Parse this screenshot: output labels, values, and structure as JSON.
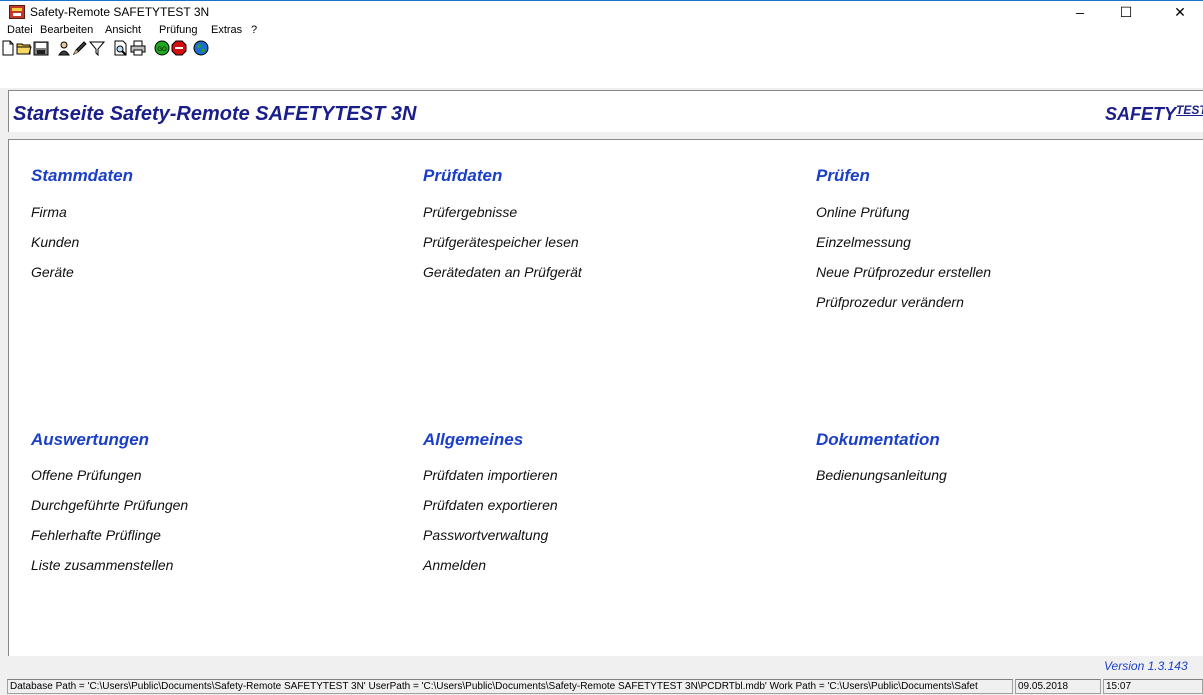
{
  "window": {
    "title": "Safety-Remote SAFETYTEST 3N",
    "controls": {
      "minimize": "–",
      "maximize": "☐",
      "close": "✕"
    }
  },
  "menu": [
    "Datei",
    "Bearbeiten",
    "Ansicht",
    "Prüfung",
    "Extras",
    "?"
  ],
  "toolbar": {
    "icons": [
      "new-file-icon",
      "open-folder-icon",
      "save-icon",
      "user-icon",
      "edit-icon",
      "filter-icon",
      "print-preview-icon",
      "print-icon",
      "start-test-icon",
      "stop-icon",
      "globe-icon"
    ],
    "colors": {
      "start": "#1faa1f",
      "stop": "#d01010",
      "globe": "#1a6fd0"
    }
  },
  "header": {
    "title": "Startseite  Safety-Remote SAFETYTEST 3N",
    "brand_main": "SAFETY",
    "brand_sup": "TEST"
  },
  "sections": {
    "stammdaten": {
      "title": "Stammdaten",
      "links": [
        "Firma",
        "Kunden",
        "Geräte"
      ]
    },
    "pruefdaten": {
      "title": "Prüfdaten",
      "links": [
        "Prüfergebnisse",
        "Prüfgerätespeicher lesen",
        "Gerätedaten an Prüfgerät"
      ]
    },
    "pruefen": {
      "title": "Prüfen",
      "links": [
        "Online Prüfung",
        "Einzelmessung",
        "Neue Prüfprozedur erstellen",
        "Prüfprozedur verändern"
      ]
    },
    "auswertungen": {
      "title": "Auswertungen",
      "links": [
        "Offene Prüfungen",
        "Durchgeführte Prüfungen",
        "Fehlerhafte Prüflinge",
        "Liste zusammenstellen"
      ]
    },
    "allgemeines": {
      "title": "Allgemeines",
      "links": [
        "Prüfdaten importieren",
        "Prüfdaten exportieren",
        "Passwortverwaltung",
        "Anmelden"
      ]
    },
    "dokumentation": {
      "title": "Dokumentation",
      "links": [
        "Bedienungsanleitung"
      ]
    }
  },
  "version": "Version 1.3.143",
  "status": {
    "paths": "Database Path = 'C:\\Users\\Public\\Documents\\Safety-Remote SAFETYTEST 3N' UserPath = 'C:\\Users\\Public\\Documents\\Safety-Remote SAFETYTEST 3N\\PCDRTbl.mdb' Work Path = 'C:\\Users\\Public\\Documents\\Safet",
    "date": "09.05.2018",
    "time": "15:07"
  },
  "colors": {
    "heading": "#1a1e8a",
    "section": "#1a3fc8"
  }
}
